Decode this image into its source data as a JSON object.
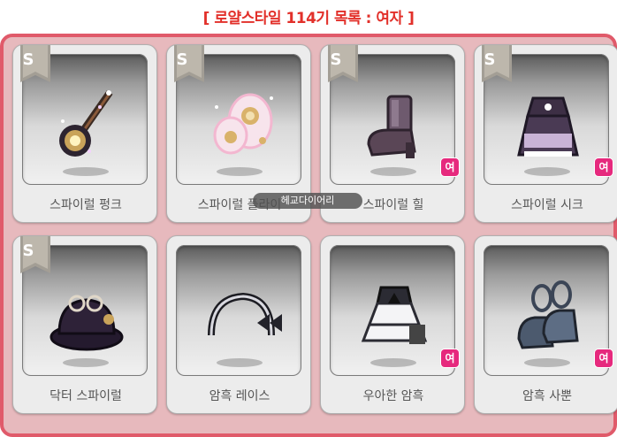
{
  "header": {
    "title": "[ 로얄스타일 114기 목록 : 여자 ]"
  },
  "colors": {
    "title": "#e2302a",
    "frame": "#e05a6a",
    "badge": "#e6297d"
  },
  "watermark": "헤교다이어리",
  "items": [
    {
      "name": "스파이럴 펑크",
      "grade": "S",
      "female": "",
      "icon": "spiral-punk-weapon-icon"
    },
    {
      "name": "스파이럴 플라이",
      "grade": "S",
      "female": "",
      "icon": "spiral-fly-wings-icon"
    },
    {
      "name": "스파이럴 힐",
      "grade": "S",
      "female": "여",
      "icon": "spiral-heel-shoe-icon"
    },
    {
      "name": "스파이럴 시크",
      "grade": "S",
      "female": "여",
      "icon": "spiral-chic-dress-icon"
    },
    {
      "name": "닥터 스파이럴",
      "grade": "S",
      "female": "",
      "icon": "doctor-spiral-hat-icon"
    },
    {
      "name": "암흑 레이스",
      "grade": "",
      "female": "",
      "icon": "dark-lace-headband-icon"
    },
    {
      "name": "우아한 암흑",
      "grade": "",
      "female": "여",
      "icon": "elegant-dark-dress-icon"
    },
    {
      "name": "암흑 사뿐",
      "grade": "",
      "female": "여",
      "icon": "dark-light-shoes-icon"
    }
  ]
}
